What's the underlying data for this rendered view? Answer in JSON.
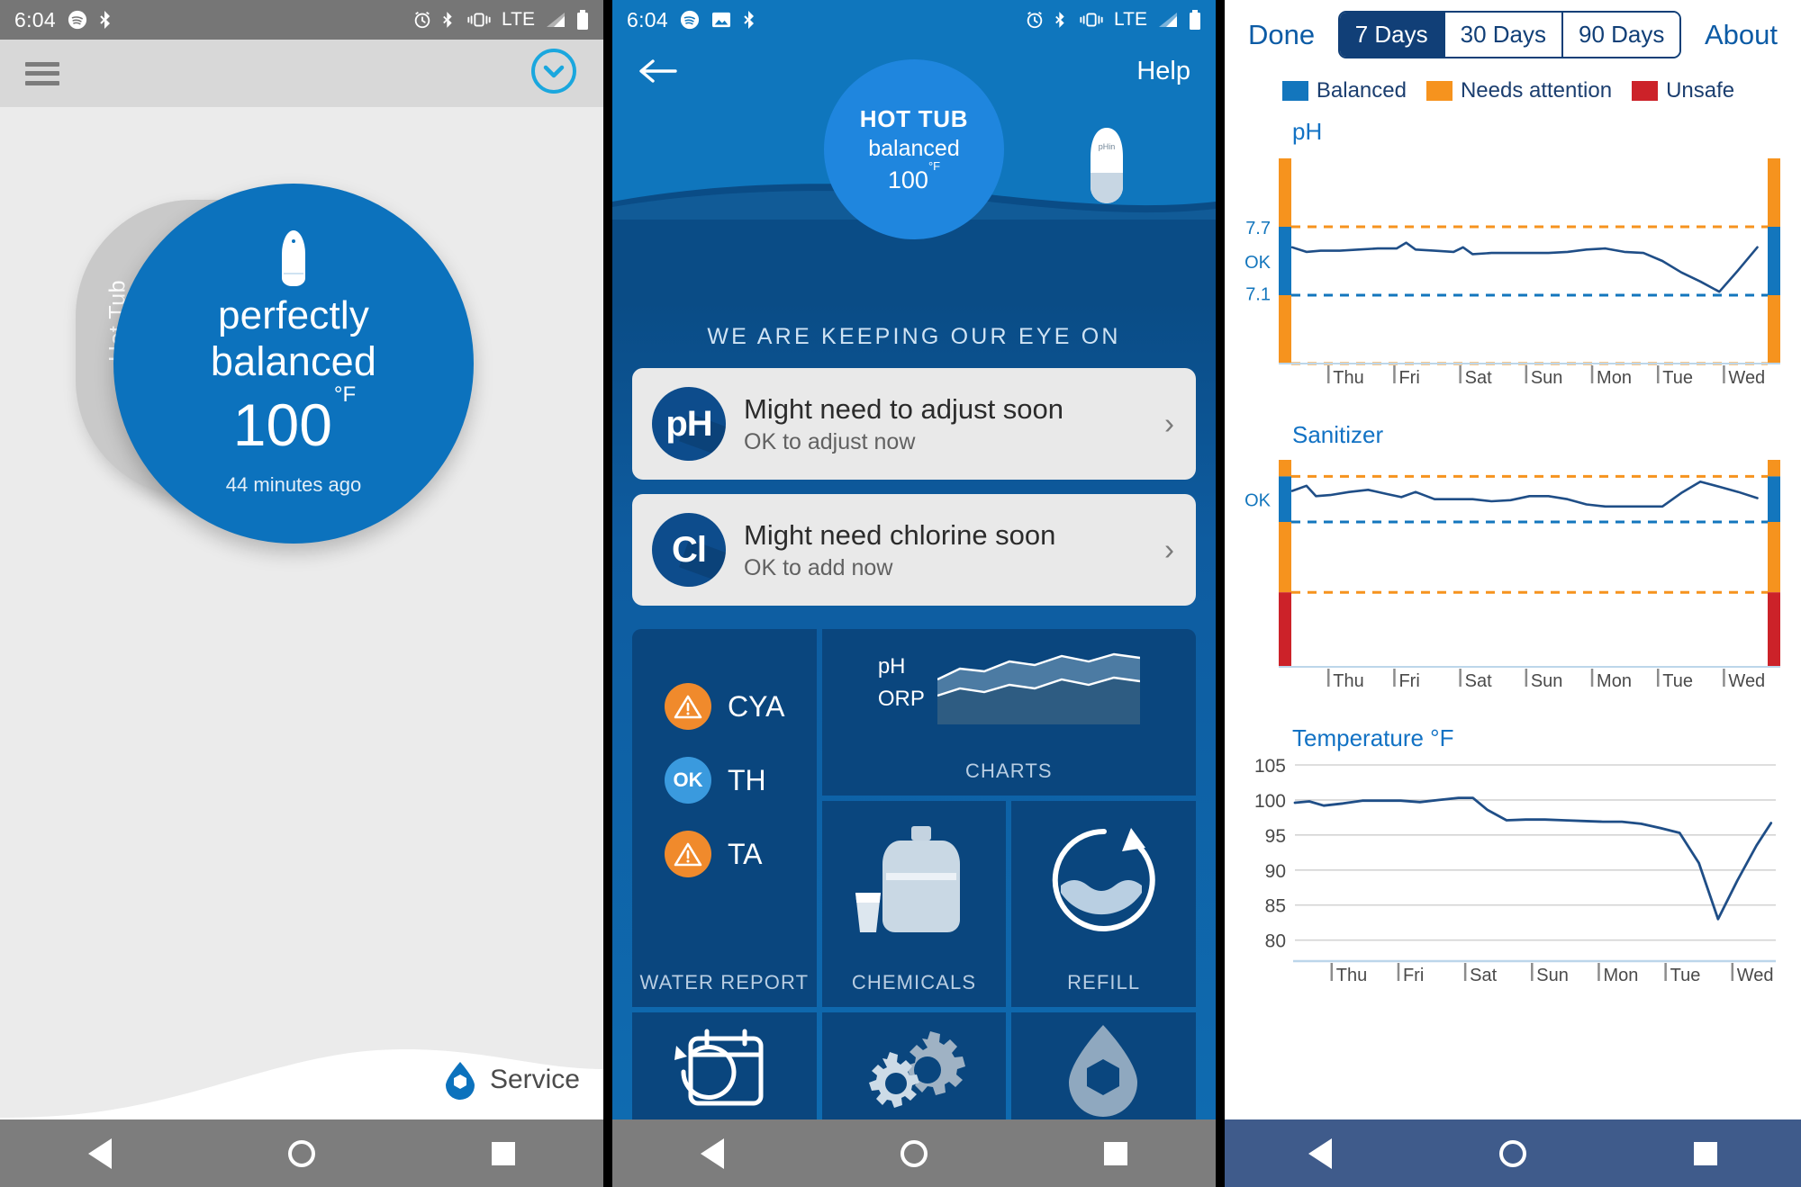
{
  "panel1": {
    "statusbar": {
      "time": "6:04",
      "left_icons": [
        "spotify-icon",
        "bluetooth-audio-icon"
      ],
      "right_icons": [
        "alarm-icon",
        "bluetooth-icon",
        "vibrate-icon",
        "lte-label",
        "signal-icon",
        "battery-icon"
      ],
      "network": "LTE"
    },
    "appbar": {
      "menu": "hamburger-icon",
      "expand": "chevron-down-circle-icon"
    },
    "bubble": {
      "tab_label": "Hot Tub",
      "line1": "perfectly",
      "line2": "balanced",
      "temperature": "100",
      "unit": "°F",
      "timestamp": "44 minutes ago"
    },
    "service": {
      "label": "Service",
      "icon": "service-drop-icon"
    },
    "navbar": {
      "back": "back-triangle-icon",
      "home": "home-circle-icon",
      "recents": "recents-square-icon"
    }
  },
  "panel2": {
    "statusbar": {
      "time": "6:04",
      "left_icons": [
        "spotify-icon",
        "photo-icon",
        "bluetooth-audio-icon"
      ],
      "right_icons": [
        "alarm-icon",
        "bluetooth-icon",
        "vibrate-icon",
        "lte-label",
        "signal-icon",
        "battery-icon"
      ],
      "network": "LTE"
    },
    "topbar": {
      "back": "back-arrow-icon",
      "help": "Help"
    },
    "hero_bubble": {
      "title": "HOT TUB",
      "status": "balanced",
      "temperature": "100",
      "unit": "°F",
      "floater": "float-sensor-icon"
    },
    "section_heading": "WE ARE KEEPING OUR EYE ON",
    "alerts": [
      {
        "badge": "pH",
        "title": "Might need to adjust soon",
        "subtitle": "OK to adjust now",
        "chevron": "chevron-right-icon"
      },
      {
        "badge": "Cl",
        "title": "Might need chlorine soon",
        "subtitle": "OK to add now",
        "chevron": "chevron-right-icon"
      }
    ],
    "tiles": {
      "water_report": {
        "label": "WATER REPORT",
        "rows": [
          {
            "status": "warn",
            "badge": "!",
            "name": "CYA"
          },
          {
            "status": "ok",
            "badge": "OK",
            "name": "TH"
          },
          {
            "status": "warn",
            "badge": "!",
            "name": "TA"
          }
        ]
      },
      "charts": {
        "label": "CHARTS",
        "series": [
          "pH",
          "ORP"
        ],
        "icon": "area-chart-icon"
      },
      "chemicals": {
        "label": "CHEMICALS",
        "icon": "chemical-bottle-icon"
      },
      "refill": {
        "label": "REFILL",
        "icon": "refill-arrow-icon"
      },
      "schedule": {
        "label": "",
        "icon": "calendar-refresh-icon"
      },
      "settings": {
        "label": "",
        "icon": "gears-icon"
      },
      "water_drop": {
        "label": "",
        "icon": "water-drop-icon"
      }
    },
    "navbar": {
      "back": "back-triangle-icon",
      "home": "home-circle-icon",
      "recents": "recents-square-icon"
    }
  },
  "panel3": {
    "header": {
      "done": "Done",
      "about": "About",
      "ranges": [
        {
          "label": "7 Days",
          "active": true
        },
        {
          "label": "30 Days",
          "active": false
        },
        {
          "label": "90 Days",
          "active": false
        }
      ]
    },
    "legend": [
      {
        "label": "Balanced",
        "color": "#1376bd"
      },
      {
        "label": "Needs attention",
        "color": "#f6931e"
      },
      {
        "label": "Unsafe",
        "color": "#cc2229"
      }
    ],
    "navbar": {
      "back": "back-triangle-icon",
      "home": "home-circle-icon",
      "recents": "recents-square-icon"
    }
  },
  "chart_data": [
    {
      "type": "line",
      "title": "pH",
      "xlabel": "",
      "ylabel": "pH",
      "grid": false,
      "legend_position": "top",
      "ylim": [
        6.5,
        8.3
      ],
      "ytick_labels": [
        "7.7",
        "OK",
        "7.1"
      ],
      "band_upper": 7.7,
      "band_lower": 7.1,
      "tick_labels": [
        "Thu",
        "Fri",
        "Sat",
        "Sun",
        "Mon",
        "Tue",
        "Wed"
      ],
      "zones": [
        {
          "label": "Needs attention",
          "color": "#f6931e",
          "from": 7.7,
          "to": 8.3
        },
        {
          "label": "Balanced",
          "color": "#1376bd",
          "from": 7.1,
          "to": 7.7
        },
        {
          "label": "Needs attention",
          "color": "#f6931e",
          "from": 6.5,
          "to": 7.1
        }
      ],
      "x": [
        0,
        3,
        6,
        10,
        14,
        18,
        22,
        24,
        26,
        30,
        34,
        36,
        38,
        42,
        46,
        50,
        54,
        58,
        62,
        66,
        70,
        74,
        78,
        82,
        86,
        90,
        94,
        98
      ],
      "values": [
        7.52,
        7.48,
        7.49,
        7.49,
        7.5,
        7.51,
        7.51,
        7.56,
        7.5,
        7.49,
        7.48,
        7.52,
        7.46,
        7.47,
        7.47,
        7.47,
        7.47,
        7.48,
        7.5,
        7.51,
        7.48,
        7.47,
        7.4,
        7.3,
        7.22,
        7.13,
        7.32,
        7.52
      ]
    },
    {
      "type": "line",
      "title": "Sanitizer",
      "xlabel": "",
      "ylabel": "Sanitizer",
      "grid": false,
      "legend_position": "top",
      "ylim": [
        0,
        10
      ],
      "ytick_labels": [
        "OK"
      ],
      "band_upper": 9.2,
      "band_lower": 7.0,
      "tick_labels": [
        "Thu",
        "Fri",
        "Sat",
        "Sun",
        "Mon",
        "Tue",
        "Wed"
      ],
      "zones": [
        {
          "label": "Needs attention",
          "color": "#f6931e",
          "from": 9.2,
          "to": 10
        },
        {
          "label": "Balanced",
          "color": "#1376bd",
          "from": 7.0,
          "to": 9.2
        },
        {
          "label": "Needs attention",
          "color": "#f6931e",
          "from": 3.6,
          "to": 7.0
        },
        {
          "label": "Unsafe",
          "color": "#cc2229",
          "from": 0,
          "to": 3.6
        }
      ],
      "x": [
        0,
        3,
        5,
        8,
        12,
        16,
        20,
        23,
        26,
        30,
        34,
        38,
        42,
        46,
        50,
        54,
        58,
        62,
        66,
        70,
        74,
        78,
        82,
        86,
        90,
        94,
        98
      ],
      "values": [
        8.5,
        8.75,
        8.25,
        8.3,
        8.45,
        8.55,
        8.35,
        8.2,
        8.45,
        8.1,
        8.1,
        8.1,
        8.0,
        8.05,
        8.25,
        8.25,
        8.1,
        7.85,
        7.75,
        7.75,
        7.75,
        7.75,
        8.4,
        8.95,
        8.7,
        8.45,
        8.15
      ]
    },
    {
      "type": "line",
      "title": "Temperature °F",
      "xlabel": "",
      "ylabel": "Temperature °F",
      "grid": true,
      "legend_position": "none",
      "ylim": [
        77,
        105
      ],
      "yticks": [
        80,
        85,
        90,
        95,
        100,
        105
      ],
      "ytick_labels": [
        "80",
        "85",
        "90",
        "95",
        "100",
        "105"
      ],
      "tick_labels": [
        "Thu",
        "Fri",
        "Sat",
        "Sun",
        "Mon",
        "Tue",
        "Wed"
      ],
      "x": [
        0,
        3,
        6,
        10,
        14,
        18,
        22,
        26,
        30,
        34,
        37,
        40,
        44,
        48,
        52,
        56,
        60,
        64,
        68,
        72,
        76,
        80,
        84,
        88,
        92,
        96,
        99
      ],
      "values": [
        99.6,
        99.8,
        99.2,
        99.5,
        99.9,
        99.9,
        99.9,
        99.7,
        100.0,
        100.3,
        100.3,
        98.6,
        97.1,
        97.2,
        97.2,
        97.1,
        97.0,
        96.9,
        96.9,
        96.6,
        96.0,
        95.3,
        91.0,
        83.0,
        88.5,
        93.5,
        96.7
      ]
    }
  ]
}
